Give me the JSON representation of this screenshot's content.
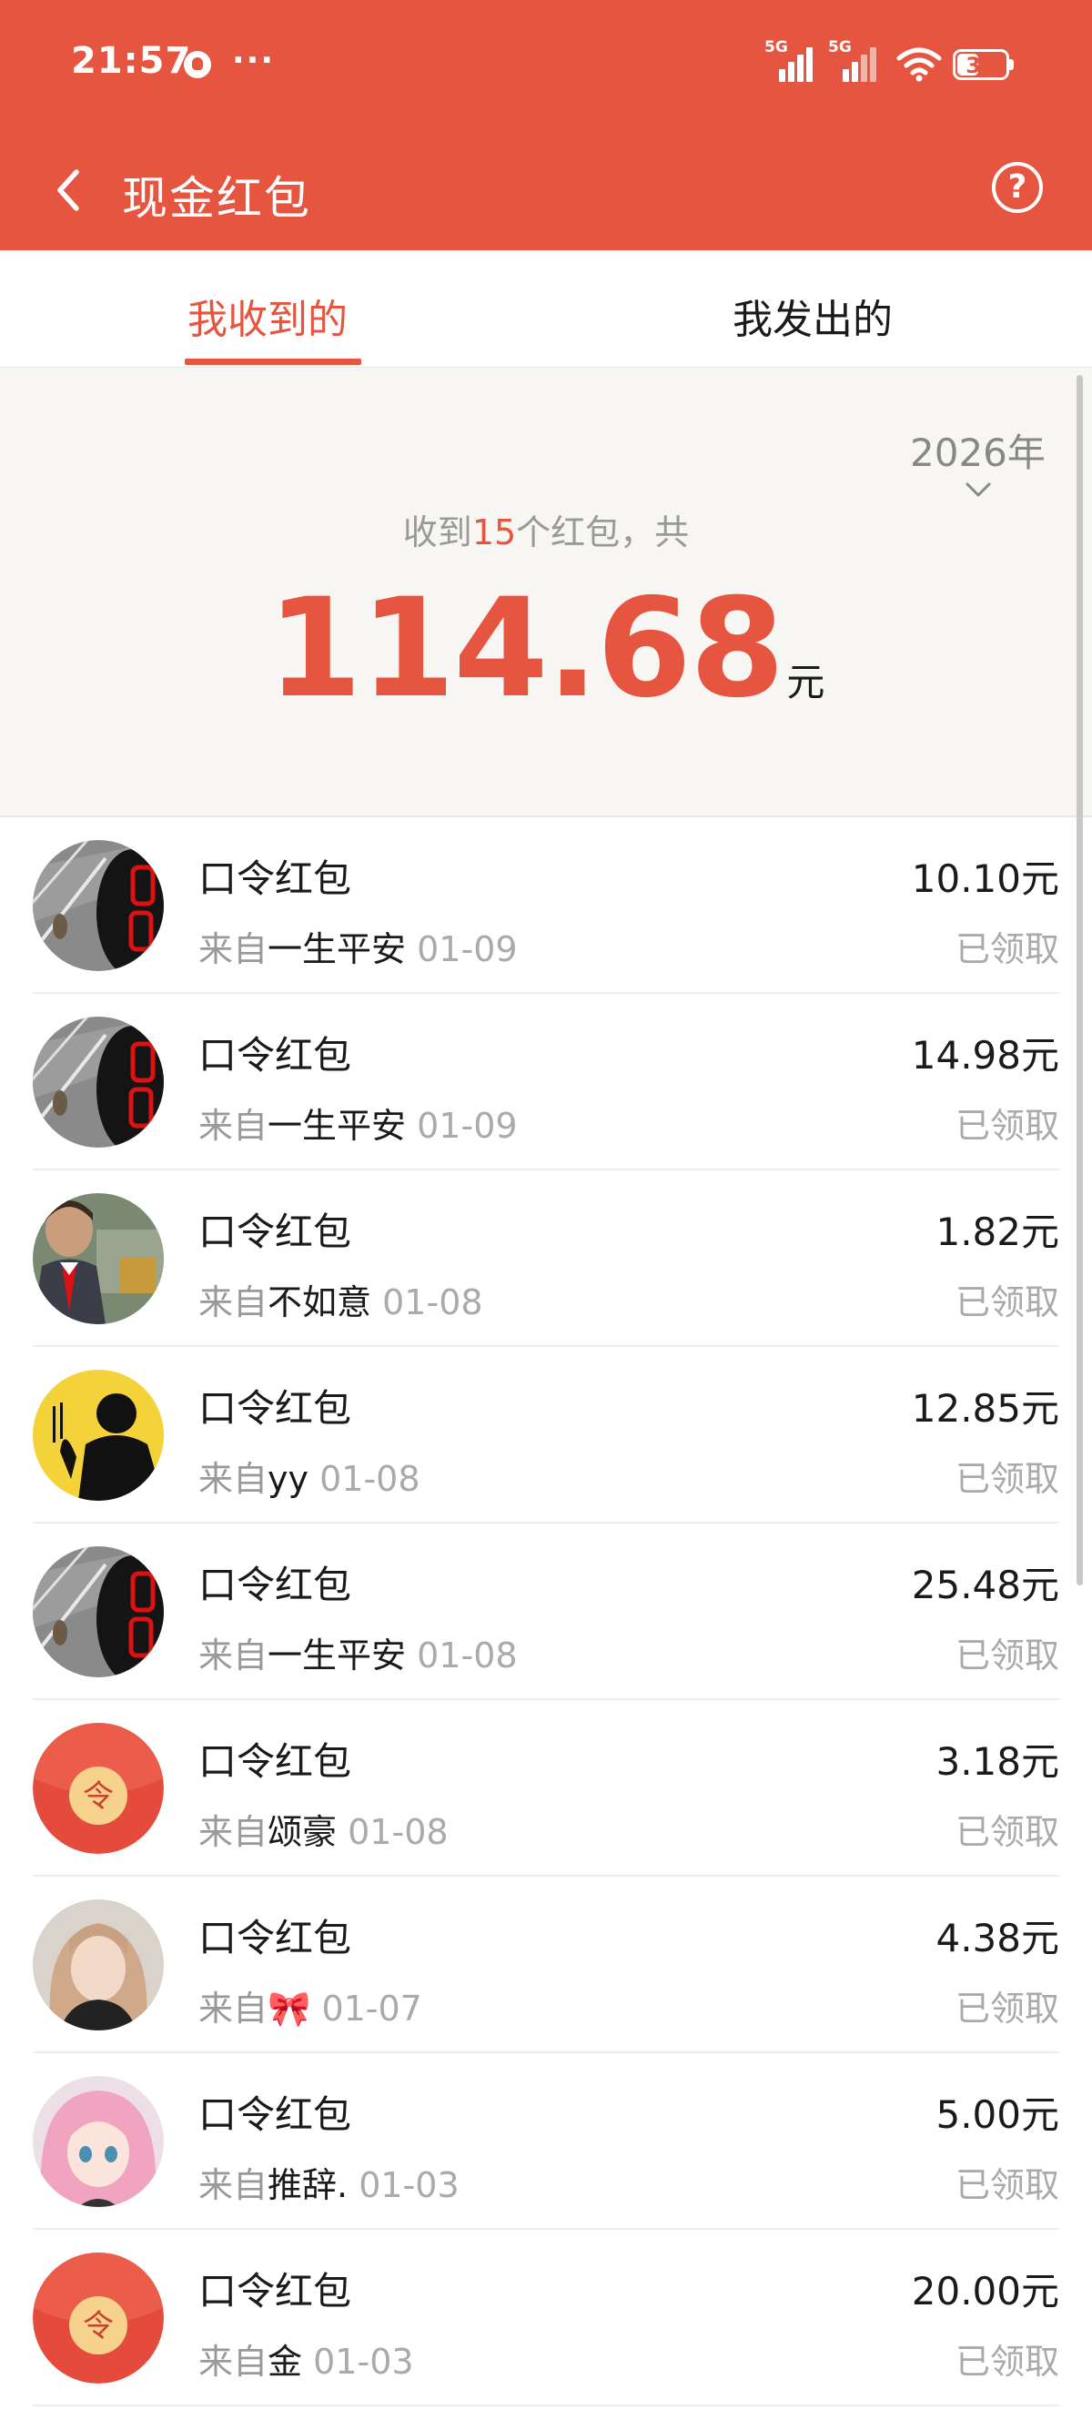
{
  "status_bar": {
    "time": "21:57",
    "more": "···",
    "signal_1": "5G",
    "signal_2": "5G",
    "battery": "39"
  },
  "nav": {
    "title": "现金红包",
    "help": "?"
  },
  "tabs": [
    {
      "label": "我收到的",
      "active": true
    },
    {
      "label": "我发出的",
      "active": false
    }
  ],
  "summary": {
    "year": "2026年",
    "prefix": "收到",
    "count": "15",
    "suffix": "个红包，共",
    "total": "114.68",
    "unit": "元"
  },
  "list": [
    {
      "title": "口令红包",
      "from": "来自",
      "sender": "一生平安",
      "date": "01-09",
      "amount": "10.10元",
      "status": "已领取",
      "avatar": "street-photo"
    },
    {
      "title": "口令红包",
      "from": "来自",
      "sender": "一生平安",
      "date": "01-09",
      "amount": "14.98元",
      "status": "已领取",
      "avatar": "street-photo"
    },
    {
      "title": "口令红包",
      "from": "来自",
      "sender": "不如意",
      "date": "01-08",
      "amount": "1.82元",
      "status": "已领取",
      "avatar": "man-photo"
    },
    {
      "title": "口令红包",
      "from": "来自",
      "sender": "yy",
      "date": "01-08",
      "amount": "12.85元",
      "status": "已领取",
      "avatar": "silhouette-yellow"
    },
    {
      "title": "口令红包",
      "from": "来自",
      "sender": "一生平安",
      "date": "01-08",
      "amount": "25.48元",
      "status": "已领取",
      "avatar": "street-photo"
    },
    {
      "title": "口令红包",
      "from": "来自",
      "sender": "颂豪",
      "date": "01-08",
      "amount": "3.18元",
      "status": "已领取",
      "avatar": "red-packet-icon"
    },
    {
      "title": "口令红包",
      "from": "来自",
      "sender": "🎀",
      "date": "01-07",
      "amount": "4.38元",
      "status": "已领取",
      "avatar": "girl-photo"
    },
    {
      "title": "口令红包",
      "from": "来自",
      "sender": "推辞.",
      "date": "01-03",
      "amount": "5.00元",
      "status": "已领取",
      "avatar": "anime-girl"
    },
    {
      "title": "口令红包",
      "from": "来自",
      "sender": "金",
      "date": "01-03",
      "amount": "20.00元",
      "status": "已领取",
      "avatar": "red-packet-icon"
    }
  ],
  "red_packet_glyph": "令",
  "colors": {
    "accent": "#e6553f",
    "background": "#f8f6f3"
  }
}
